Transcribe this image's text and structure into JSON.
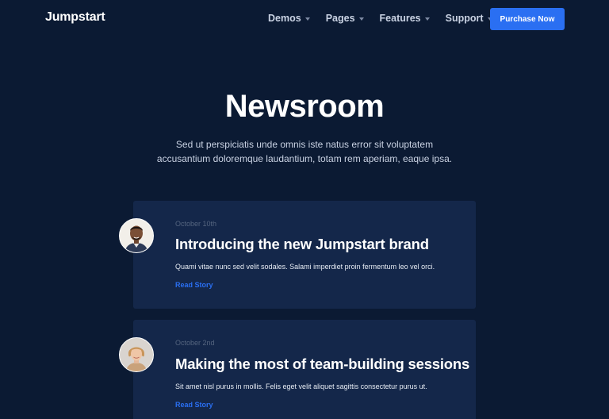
{
  "brand": {
    "name": "Jumpstart"
  },
  "nav": {
    "items": [
      {
        "label": "Demos"
      },
      {
        "label": "Pages"
      },
      {
        "label": "Features"
      },
      {
        "label": "Support"
      }
    ],
    "cta_label": "Purchase Now"
  },
  "hero": {
    "title": "Newsroom",
    "subtitle_line1": "Sed ut perspiciatis unde omnis iste natus error sit voluptatem",
    "subtitle_line2": "accusantium doloremque laudantium, totam rem aperiam, eaque ipsa."
  },
  "stories": [
    {
      "date": "October 10th",
      "title": "Introducing the new Jumpstart brand",
      "excerpt": "Quami vitae nunc sed velit sodales. Salami imperdiet proin fermentum leo vel orci.",
      "link_label": "Read Story"
    },
    {
      "date": "October 2nd",
      "title": "Making the most of team-building sessions",
      "excerpt": "Sit amet nisl purus in mollis. Felis eget velit aliquet sagittis consectetur purus ut.",
      "link_label": "Read Story"
    }
  ],
  "colors": {
    "background": "#0b1a33",
    "card": "#14274a",
    "accent": "#2a6ff2"
  }
}
